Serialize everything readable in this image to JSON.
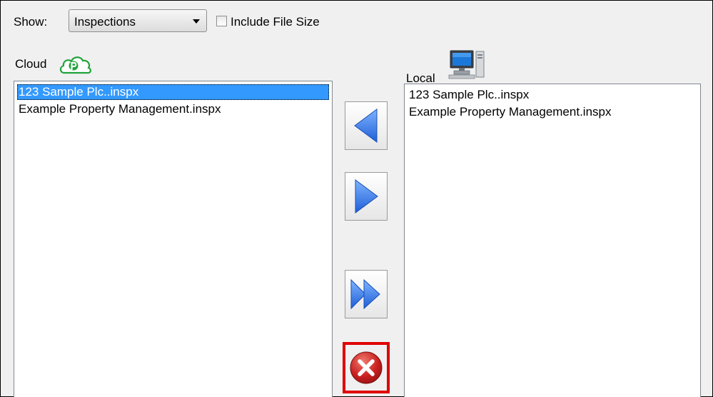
{
  "toolbar": {
    "show_label": "Show:",
    "show_value": "Inspections",
    "include_file_size_label": "Include File Size",
    "include_file_size_checked": false
  },
  "cloud": {
    "title": "Cloud",
    "icon": "cloud-icon",
    "items": [
      {
        "label": "123 Sample Plc..inspx",
        "selected": true
      },
      {
        "label": "Example Property Management.inspx",
        "selected": false
      }
    ]
  },
  "local": {
    "title": "Local",
    "icon": "computer-icon",
    "items": [
      {
        "label": "123 Sample Plc..inspx"
      },
      {
        "label": "Example Property Management.inspx"
      }
    ]
  },
  "buttons": {
    "download": "arrow-left-icon",
    "upload": "arrow-right-icon",
    "upload_all": "double-arrow-right-icon",
    "cancel": "close-circle-icon"
  },
  "colors": {
    "selection": "#3399ff",
    "arrow_blue": "#2f6fe0",
    "cancel_red": "#c8201f",
    "highlight_border": "#e00000",
    "cloud_green": "#1fa33a"
  }
}
